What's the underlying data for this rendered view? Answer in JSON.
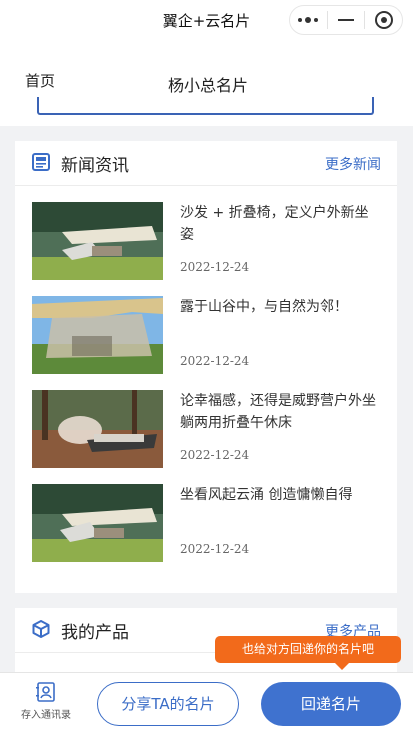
{
  "topbar": {
    "title": "翼企+云名片",
    "capsule": [
      "more-dots-icon",
      "minimize-icon",
      "close-target-icon"
    ]
  },
  "header": {
    "home": "首页",
    "page_name": "杨小总名片"
  },
  "news": {
    "title": "新闻资讯",
    "more": "更多新闻",
    "icon": "news-icon",
    "items": [
      {
        "title": "沙发 + 折叠椅，定义户外新坐姿",
        "date": "2022-12-24"
      },
      {
        "title": "露于山谷中，与自然为邻！",
        "date": "2022-12-24"
      },
      {
        "title": "论幸福感，还得是威野营户外坐躺两用折叠午休床",
        "date": "2022-12-24"
      },
      {
        "title": "坐看风起云涌 创造慵懒自得",
        "date": "2022-12-24"
      }
    ]
  },
  "products": {
    "title": "我的产品",
    "more": "更多产品",
    "icon": "cube-icon"
  },
  "tooltip": {
    "text": "也给对方回递你的名片吧"
  },
  "bottom": {
    "save_contact": "存入通讯录",
    "share": "分享TA的名片",
    "reply": "回递名片"
  },
  "colors": {
    "accent": "#3f72cf",
    "link": "#3b6dc7",
    "tooltip": "#f26a1b"
  }
}
